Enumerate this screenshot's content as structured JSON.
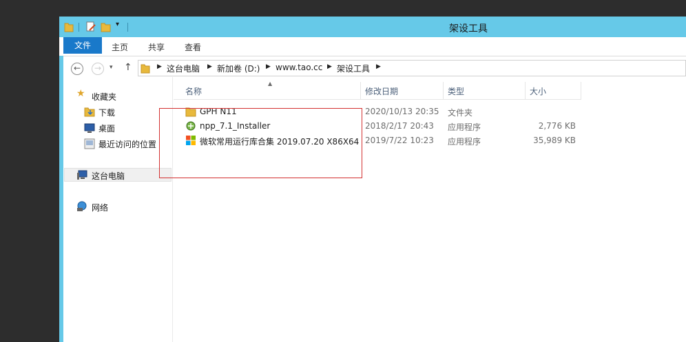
{
  "window": {
    "title": "架设工具"
  },
  "ribbon": {
    "tabs": [
      "文件",
      "主页",
      "共享",
      "查看"
    ]
  },
  "address": {
    "crumbs": [
      "这台电脑",
      "新加卷 (D:)",
      "www.tao.cc",
      "架设工具"
    ]
  },
  "nav": {
    "favorites": "收藏夹",
    "downloads": "下载",
    "desktop": "桌面",
    "recent": "最近访问的位置",
    "this_pc": "这台电脑",
    "network": "网络"
  },
  "columns": {
    "name": "名称",
    "date": "修改日期",
    "type": "类型",
    "size": "大小"
  },
  "files": [
    {
      "name": "GPH N11",
      "date": "2020/10/13 20:35",
      "type": "文件夹",
      "size": "",
      "icon": "folder-icon"
    },
    {
      "name": "npp_7.1_Installer",
      "date": "2018/2/17 20:43",
      "type": "应用程序",
      "size": "2,776 KB",
      "icon": "installer-icon"
    },
    {
      "name": "微软常用运行库合集 2019.07.20 X86X64",
      "date": "2019/7/22 10:23",
      "type": "应用程序",
      "size": "35,989 KB",
      "icon": "windows-logo-icon"
    }
  ],
  "colors": {
    "titlebar": "#66c9e8",
    "file_tab": "#1979ca",
    "highlight_box": "#d32f2f"
  }
}
